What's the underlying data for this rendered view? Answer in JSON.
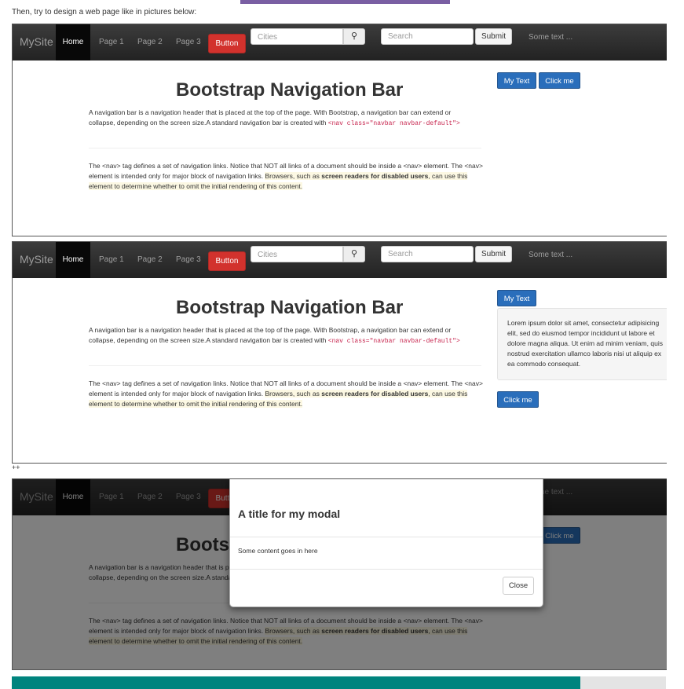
{
  "intro_text": "Then, try to design a web page like in pictures below:",
  "separator_text": "++",
  "navbar": {
    "brand": "MySite",
    "home": "Home",
    "page1": "Page 1",
    "page2": "Page 2",
    "page3": "Page 3",
    "button": "Button",
    "cities_placeholder": "Cities",
    "search_icon": "⚲",
    "search_placeholder": "Search",
    "submit": "Submit",
    "some_text": "Some text ..."
  },
  "content": {
    "heading": "Bootstrap Navigation Bar",
    "para1_text": "A navigation bar is a navigation header that is placed at the top of the page. With Bootstrap, a navigation bar can extend or collapse, depending on the screen size.A standard navigation bar is created with ",
    "para1_code": "<nav class=\"navbar navbar-default\">",
    "para2_text": "The <nav> tag defines a set of navigation links. Notice that NOT all links of a document should be inside a <nav> element. The <nav> element is intended only for major block of navigation links. ",
    "para2_hl_a": "Browsers, such as ",
    "para2_bold": "screen readers for disabled users",
    "para2_hl_b": ", can use this element to determine whether to omit the initial rendering of this content."
  },
  "buttons": {
    "my_text": "My Text",
    "click_me": "Click me"
  },
  "well_text": "Lorem ipsum dolor sit amet, consectetur adipisicing elit, sed do eiusmod tempor incididunt ut labore et dolore magna aliqua. Ut enim ad minim veniam, quis nostrud exercitation ullamco laboris nisi ut aliquip ex ea commodo consequat.",
  "modal": {
    "title": "A title for my modal",
    "body": "Some content goes in here",
    "close": "Close"
  },
  "colors": {
    "navbar_bg": "#222222",
    "danger_button": "#d2322d",
    "primary_button": "#2a6ebb",
    "teal_bar": "#00847e",
    "purple_bar": "#7a5fa3"
  }
}
